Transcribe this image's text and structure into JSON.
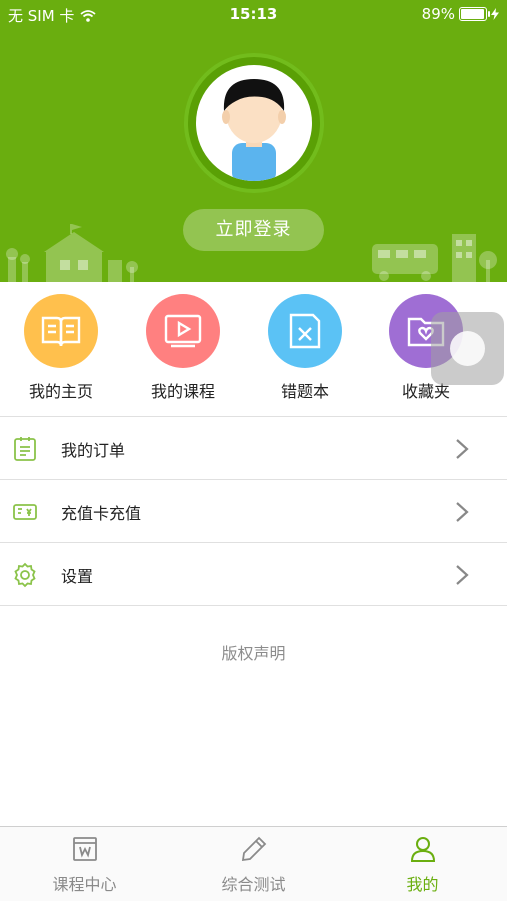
{
  "status_bar": {
    "carrier": "无 SIM 卡",
    "time": "15:13",
    "battery": "89%"
  },
  "header": {
    "login_label": "立即登录"
  },
  "quick_menu": [
    {
      "label": "我的主页",
      "color": "#ffc04d",
      "icon": "book-icon"
    },
    {
      "label": "我的课程",
      "color": "#ff8080",
      "icon": "video-icon"
    },
    {
      "label": "错题本",
      "color": "#5bc2f5",
      "icon": "wrong-questions-icon"
    },
    {
      "label": "收藏夹",
      "color": "#9f6ed4",
      "icon": "favorites-folder-icon"
    }
  ],
  "list": [
    {
      "label": "我的订单",
      "icon": "order-list-icon"
    },
    {
      "label": "充值卡充值",
      "icon": "recharge-card-icon"
    },
    {
      "label": "设置",
      "icon": "settings-gear-icon"
    }
  ],
  "copyright_label": "版权声明",
  "tabs": [
    {
      "label": "课程中心",
      "icon": "course-center-icon",
      "active": false
    },
    {
      "label": "综合测试",
      "icon": "pencil-icon",
      "active": false
    },
    {
      "label": "我的",
      "icon": "person-icon",
      "active": true
    }
  ],
  "colors": {
    "brand": "#6aae0f",
    "list_icon": "#8bc34a"
  }
}
